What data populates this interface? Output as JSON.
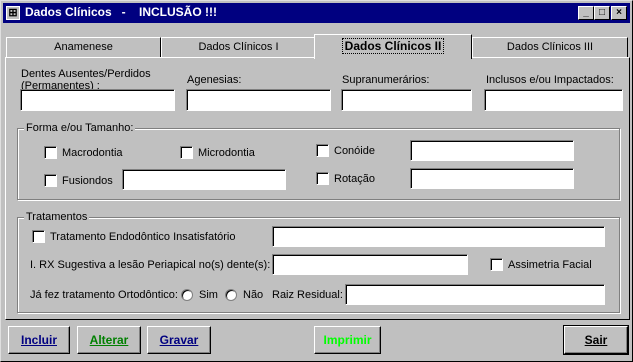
{
  "window": {
    "title": "Dados Clínicos   -    INCLUSÃO !!!",
    "controls": [
      "_",
      "□",
      "×"
    ]
  },
  "tabs": [
    {
      "label": "Anamenese"
    },
    {
      "label": "Dados Clínicos I"
    },
    {
      "label": "Dados Clínicos II",
      "active": true
    },
    {
      "label": "Dados Clínicos III"
    }
  ],
  "top_fields": {
    "dentes_ausentes": {
      "label": "Dentes Ausentes/Perdidos",
      "label2": "(Permanentes) :",
      "value": ""
    },
    "agenesias": {
      "label": "Agenesias:",
      "value": ""
    },
    "supranumerarios": {
      "label": "Supranumerários:",
      "value": ""
    },
    "inclusos": {
      "label": "Inclusos e/ou Impactados:",
      "value": ""
    }
  },
  "forma_tamanho": {
    "title": "Forma e/ou Tamanho:",
    "macrodontia": {
      "label": "Macrodontia",
      "checked": false
    },
    "microdontia": {
      "label": "Microdontia",
      "checked": false
    },
    "conoide": {
      "label": "Conóide",
      "checked": false,
      "value": ""
    },
    "fusiondos": {
      "label": "Fusiondos",
      "checked": false,
      "value": ""
    },
    "rotacao": {
      "label": "Rotação",
      "checked": false,
      "value": ""
    }
  },
  "tratamentos": {
    "title": "Tratamentos",
    "endodontico": {
      "label": "Tratamento Endodôntico Insatisfatório",
      "checked": false,
      "value": ""
    },
    "rx_label": "I. RX Sugestiva a lesão Periapical no(s) dente(s):",
    "rx_value": "",
    "assimetria": {
      "label": "Assimetria Facial",
      "checked": false
    },
    "ortodontico_label": "Já fez tratamento Ortodôntico:",
    "sim": "Sim",
    "nao": "Não",
    "raiz_label": "Raiz Residual:",
    "raiz_value": ""
  },
  "buttons": {
    "incluir": "Incluir",
    "alterar": "Alterar",
    "gravar": "Gravar",
    "imprimir": "Imprimir",
    "sair": "Sair"
  },
  "colors": {
    "titlebar": "#000080",
    "face": "#c0c0c0",
    "primary_button_text": "#000080",
    "alterar_text": "#008000",
    "imprimir_text": "#00ff00"
  }
}
